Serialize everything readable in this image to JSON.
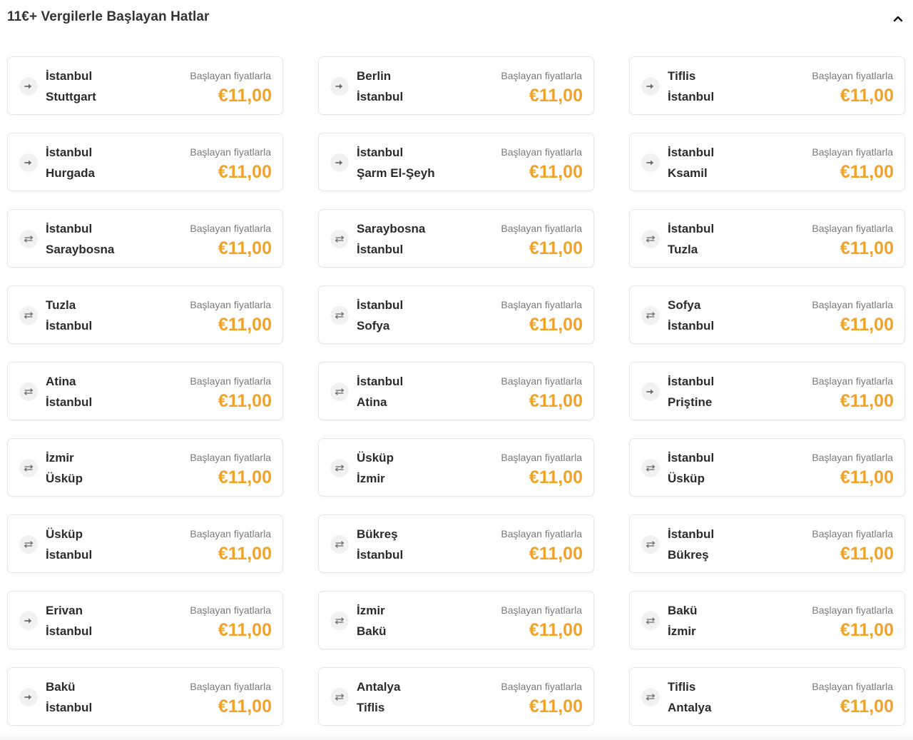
{
  "section": {
    "title": "11€+ Vergilerle Başlayan Hatlar",
    "collapse_icon": "chevron-up-icon"
  },
  "price_label": "Başlayan fiyatlarla",
  "routes": [
    {
      "from": "İstanbul",
      "to": "Stuttgart",
      "direction": "one-way",
      "price": "€11,00"
    },
    {
      "from": "Berlin",
      "to": "İstanbul",
      "direction": "one-way",
      "price": "€11,00"
    },
    {
      "from": "Tiflis",
      "to": "İstanbul",
      "direction": "one-way",
      "price": "€11,00"
    },
    {
      "from": "İstanbul",
      "to": "Hurgada",
      "direction": "one-way",
      "price": "€11,00"
    },
    {
      "from": "İstanbul",
      "to": "Şarm El-Şeyh",
      "direction": "one-way",
      "price": "€11,00"
    },
    {
      "from": "İstanbul",
      "to": "Ksamil",
      "direction": "one-way",
      "price": "€11,00"
    },
    {
      "from": "İstanbul",
      "to": "Saraybosna",
      "direction": "round-trip",
      "price": "€11,00"
    },
    {
      "from": "Saraybosna",
      "to": "İstanbul",
      "direction": "round-trip",
      "price": "€11,00"
    },
    {
      "from": "İstanbul",
      "to": "Tuzla",
      "direction": "round-trip",
      "price": "€11,00"
    },
    {
      "from": "Tuzla",
      "to": "İstanbul",
      "direction": "round-trip",
      "price": "€11,00"
    },
    {
      "from": "İstanbul",
      "to": "Sofya",
      "direction": "round-trip",
      "price": "€11,00"
    },
    {
      "from": "Sofya",
      "to": "İstanbul",
      "direction": "round-trip",
      "price": "€11,00"
    },
    {
      "from": "Atina",
      "to": "İstanbul",
      "direction": "round-trip",
      "price": "€11,00"
    },
    {
      "from": "İstanbul",
      "to": "Atina",
      "direction": "round-trip",
      "price": "€11,00"
    },
    {
      "from": "İstanbul",
      "to": "Priştine",
      "direction": "one-way",
      "price": "€11,00"
    },
    {
      "from": "İzmir",
      "to": "Üsküp",
      "direction": "round-trip",
      "price": "€11,00"
    },
    {
      "from": "Üsküp",
      "to": "İzmir",
      "direction": "round-trip",
      "price": "€11,00"
    },
    {
      "from": "İstanbul",
      "to": "Üsküp",
      "direction": "round-trip",
      "price": "€11,00"
    },
    {
      "from": "Üsküp",
      "to": "İstanbul",
      "direction": "round-trip",
      "price": "€11,00"
    },
    {
      "from": "Bükreş",
      "to": "İstanbul",
      "direction": "round-trip",
      "price": "€11,00"
    },
    {
      "from": "İstanbul",
      "to": "Bükreş",
      "direction": "round-trip",
      "price": "€11,00"
    },
    {
      "from": "Erivan",
      "to": "İstanbul",
      "direction": "one-way",
      "price": "€11,00"
    },
    {
      "from": "İzmir",
      "to": "Bakü",
      "direction": "round-trip",
      "price": "€11,00"
    },
    {
      "from": "Bakü",
      "to": "İzmir",
      "direction": "round-trip",
      "price": "€11,00"
    },
    {
      "from": "Bakü",
      "to": "İstanbul",
      "direction": "one-way",
      "price": "€11,00"
    },
    {
      "from": "Antalya",
      "to": "Tiflis",
      "direction": "round-trip",
      "price": "€11,00"
    },
    {
      "from": "Tiflis",
      "to": "Antalya",
      "direction": "round-trip",
      "price": "€11,00"
    }
  ],
  "colors": {
    "price": "#f0a32a",
    "icon_bg": "#f1f1f1",
    "icon_fg": "#6b6b6b",
    "card_border": "#e6e6e6"
  }
}
